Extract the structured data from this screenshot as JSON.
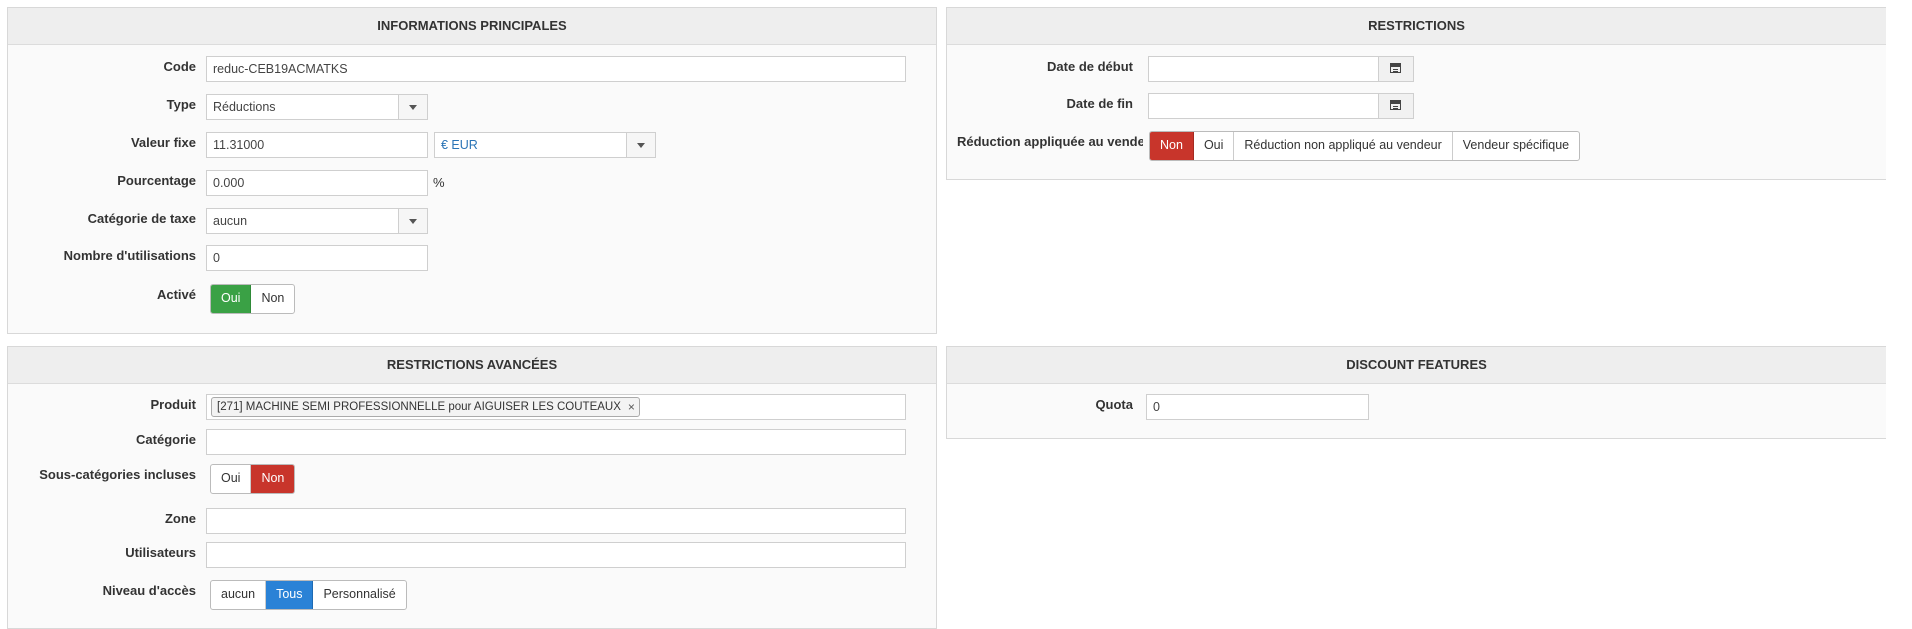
{
  "main": {
    "title": "INFORMATIONS PRINCIPALES",
    "code_label": "Code",
    "code_value": "reduc-CEB19ACMATKS",
    "type_label": "Type",
    "type_value": "Réductions",
    "fixed_label": "Valeur fixe",
    "fixed_value": "11.31000",
    "currency_value": "€ EUR",
    "percent_label": "Pourcentage",
    "percent_value": "0.000",
    "percent_unit": "%",
    "tax_label": "Catégorie de taxe",
    "tax_value": "aucun",
    "uses_label": "Nombre d'utilisations",
    "uses_value": "0",
    "active_label": "Activé",
    "active_yes": "Oui",
    "active_no": "Non"
  },
  "restrictions": {
    "title": "RESTRICTIONS",
    "start_label": "Date de début",
    "start_value": "",
    "end_label": "Date de fin",
    "end_value": "",
    "vendor_label": "Réduction appliquée au vendeur",
    "vendor_options": [
      "Non",
      "Oui",
      "Réduction non appliqué au vendeur",
      "Vendeur spécifique"
    ]
  },
  "advanced": {
    "title": "RESTRICTIONS AVANCÉES",
    "product_label": "Produit",
    "product_tag": "[271] MACHINE SEMI PROFESSIONNELLE pour AIGUISER LES COUTEAUX",
    "category_label": "Catégorie",
    "category_value": "",
    "subcat_label": "Sous-catégories incluses",
    "subcat_yes": "Oui",
    "subcat_no": "Non",
    "zone_label": "Zone",
    "zone_value": "",
    "users_label": "Utilisateurs",
    "users_value": "",
    "access_label": "Niveau d'accès",
    "access_options": [
      "aucun",
      "Tous",
      "Personnalisé"
    ]
  },
  "features": {
    "title": "DISCOUNT FEATURES",
    "quota_label": "Quota",
    "quota_value": "0"
  },
  "colors": {
    "green": "#3aa145",
    "red": "#c8352b",
    "blue": "#2a82d6"
  }
}
